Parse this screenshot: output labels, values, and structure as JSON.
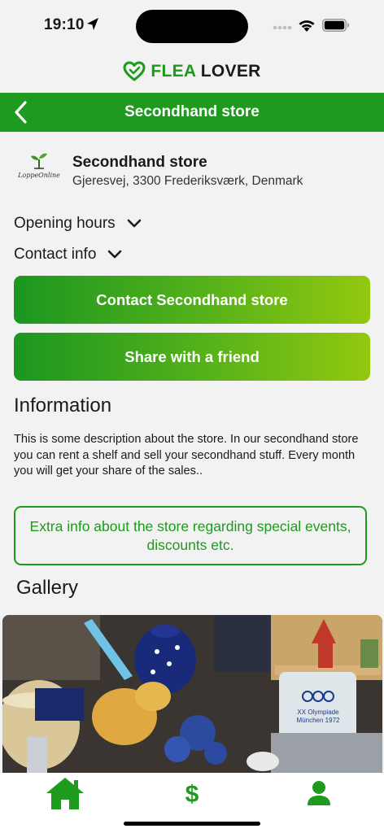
{
  "status_bar": {
    "time": "19:10"
  },
  "brand": {
    "name_part1": "FLEA",
    "name_part2": "LOVER",
    "accent_color": "#1e9a1e"
  },
  "header": {
    "title": "Secondhand store"
  },
  "store": {
    "logo_text": "LoppeOnline",
    "name": "Secondhand store",
    "address": "Gjeresvej, 3300 Frederiksværk, Denmark"
  },
  "sections": {
    "opening_hours_label": "Opening hours",
    "contact_info_label": "Contact info"
  },
  "buttons": {
    "contact_label": "Contact Secondhand store",
    "share_label": "Share with a friend"
  },
  "information": {
    "heading": "Information",
    "description": "This is some description about the store. In our secondhand store you can rent a shelf and sell your secondhand stuff. Every month you will get your share of the sales..",
    "extra_info": "Extra info about the store regarding special events, discounts etc."
  },
  "gallery": {
    "heading": "Gallery",
    "image_content": "XX Olympiade München 1972"
  },
  "tabbar": {
    "items": [
      {
        "icon": "home-icon"
      },
      {
        "icon": "dollar-icon"
      },
      {
        "icon": "user-icon"
      }
    ]
  }
}
